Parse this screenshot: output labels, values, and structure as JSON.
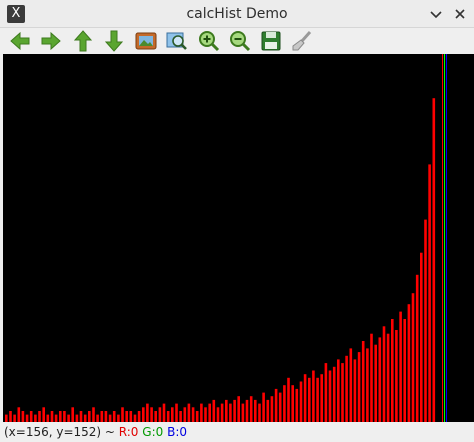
{
  "window": {
    "title": "calcHist Demo",
    "app_icon_glyph": "X"
  },
  "toolbar": {
    "buttons": [
      {
        "name": "pan-left-button",
        "icon": "arrow-left-icon"
      },
      {
        "name": "pan-right-button",
        "icon": "arrow-right-icon"
      },
      {
        "name": "pan-up-button",
        "icon": "arrow-up-icon"
      },
      {
        "name": "pan-down-button",
        "icon": "arrow-down-icon"
      },
      {
        "name": "zoom-fit-button",
        "icon": "image-icon"
      },
      {
        "name": "zoom-region-button",
        "icon": "zoom-region-icon"
      },
      {
        "name": "zoom-in-button",
        "icon": "zoom-in-icon"
      },
      {
        "name": "zoom-out-button",
        "icon": "zoom-out-icon"
      },
      {
        "name": "save-button",
        "icon": "save-icon"
      },
      {
        "name": "properties-button",
        "icon": "brush-icon"
      }
    ]
  },
  "status": {
    "coords": "(x=156, y=152) ~ ",
    "r": "R:0",
    "g": "G:0",
    "b": "B:0"
  },
  "colors": {
    "red": "#ff0000",
    "green": "#00ff00",
    "blue": "#0000ff",
    "toolbar_green": "#5aa530"
  },
  "chart_data": {
    "type": "bar",
    "series": [
      {
        "color": "red",
        "values": [
          2,
          3,
          2,
          4,
          3,
          2,
          3,
          2,
          3,
          4,
          2,
          3,
          2,
          3,
          3,
          2,
          4,
          2,
          3,
          2,
          3,
          4,
          2,
          3,
          3,
          2,
          3,
          2,
          4,
          3,
          3,
          2,
          3,
          4,
          5,
          4,
          3,
          4,
          5,
          3,
          4,
          5,
          3,
          4,
          5,
          4,
          3,
          5,
          4,
          5,
          6,
          4,
          5,
          6,
          5,
          6,
          7,
          5,
          6,
          7,
          6,
          5,
          8,
          6,
          7,
          9,
          8,
          10,
          12,
          10,
          9,
          11,
          13,
          12,
          14,
          12,
          13,
          16,
          14,
          15,
          17,
          16,
          18,
          20,
          17,
          19,
          22,
          20,
          24,
          21,
          23,
          26,
          24,
          28,
          25,
          30,
          28,
          32,
          35,
          40,
          46,
          55,
          70,
          88
        ]
      }
    ]
  }
}
